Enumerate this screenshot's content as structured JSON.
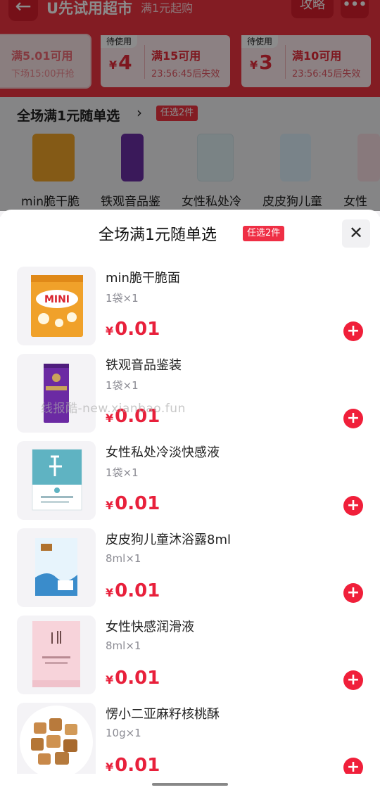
{
  "header": {
    "back_icon": "←",
    "title": "U先试用超市",
    "subtitle": "满1元起购",
    "strategy_label": "攻略",
    "more_icon": "•••"
  },
  "coupons": [
    {
      "tag": "",
      "amount": "",
      "condition": "满5.01可用",
      "expire": "下场15:00开抢"
    },
    {
      "tag": "待使用",
      "currency": "¥",
      "amount": "4",
      "condition": "满15可用",
      "expire": "23:56:45后失效"
    },
    {
      "tag": "待使用",
      "currency": "¥",
      "amount": "3",
      "condition": "满10可用",
      "expire": "23:56:45后失效"
    }
  ],
  "bg_section": {
    "title": "全场满1元随单选",
    "chevron": "›",
    "badge": "任选2件",
    "products": [
      "min脆干脆",
      "铁观音品鉴",
      "女性私处冷",
      "皮皮狗儿童",
      "女性"
    ]
  },
  "sheet": {
    "title": "全场满1元随单选",
    "badge": "任选2件",
    "close_icon": "✕",
    "watermark": "线报酷-new.xianbao.fun",
    "items": [
      {
        "name": "min脆干脆面",
        "spec": "1袋×1",
        "currency": "¥",
        "price": "0.01",
        "add": "+"
      },
      {
        "name": "铁观音品鉴装",
        "spec": "1袋×1",
        "currency": "¥",
        "price": "0.01",
        "add": "+"
      },
      {
        "name": "女性私处冷淡快感液",
        "spec": "1袋×1",
        "currency": "¥",
        "price": "0.01",
        "add": "+"
      },
      {
        "name": "皮皮狗儿童沐浴露8ml",
        "spec": "8ml×1",
        "currency": "¥",
        "price": "0.01",
        "add": "+"
      },
      {
        "name": "女性快感润滑液",
        "spec": "8ml×1",
        "currency": "¥",
        "price": "0.01",
        "add": "+"
      },
      {
        "name": "愣小二亚麻籽核桃酥",
        "spec": "10g×1",
        "currency": "¥",
        "price": "0.01",
        "add": "+"
      }
    ]
  },
  "colors": {
    "brand_red": "#ef3340",
    "price_red": "#e8203b"
  }
}
